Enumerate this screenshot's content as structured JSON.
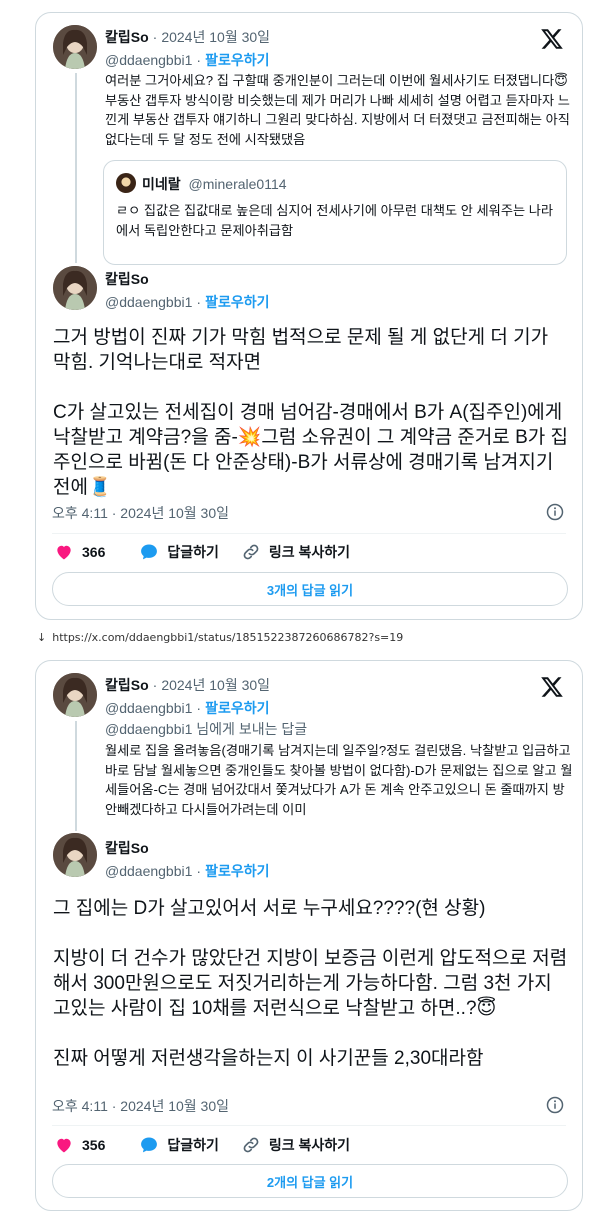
{
  "post1": {
    "parent": {
      "name": "칼립So",
      "date": "2024년 10월 30일",
      "handle": "@ddaengbbi1",
      "follow": "팔로우하기",
      "text": "여러분 그거아세요? 집 구할때 중개인분이 그러는데 이번에 월세사기도 터졌댑니다😇 부동산 갭투자 방식이랑 비슷했는데 제가 머리가 나빠 세세히 설명 어렵고 듣자마자 느낀게 부동산 갭투자 얘기하니 그원리 맞다하심. 지방에서 더 터졌댓고 금전피해는 아직없다는데 두 달 정도 전에 시작됐댔음"
    },
    "quote": {
      "name": "미네랄",
      "handle": "@minerale0114",
      "text": "ㄹㅇ 집값은 집값대로 높은데 심지어 전세사기에 아무런 대책도 안 세워주는 나라에서 독립안한다고 문제아취급함"
    },
    "main": {
      "name": "칼립So",
      "handle": "@ddaengbbi1",
      "follow": "팔로우하기",
      "para1": "그거 방법이 진짜 기가 막힘 법적으로 문제 될 게 없단게 더 기가 막힘. 기억나는대로 적자면",
      "para2": "C가 살고있는 전세집이 경매 넘어감-경매에서 B가 A(집주인)에게 낙찰받고 계약금?을 줌-💥그럼 소유권이 그 계약금 준거로 B가 집주인으로 바뀜(돈 다 안준상태)-B가 서류상에 경매기록 남겨지기전에🧵"
    },
    "timestamp": "오후 4:11 · 2024년 10월 30일",
    "likes": "366",
    "reply_label": "답글하기",
    "copy_label": "링크 복사하기",
    "read_replies": "3개의 답글 읽기"
  },
  "url_line": {
    "arrow": "↓",
    "url": "https://x.com/ddaengbbi1/status/1851522387260686782?s=19"
  },
  "post2": {
    "parent": {
      "name": "칼립So",
      "date": "2024년 10월 30일",
      "handle": "@ddaengbbi1",
      "follow": "팔로우하기",
      "reply_to": "@ddaengbbi1 님에게 보내는 답글",
      "text": "월세로 집을 올려놓음(경매기록 남겨지는데 일주일?정도 걸린댔음. 낙찰받고 입금하고 바로 담날 월세놓으면 중개인들도 찾아볼 방법이 없다함)-D가 문제없는 집으로 알고 월세들어옴-C는 경매 넘어갔대서 쫓겨났다가 A가 돈 계속 안주고있으니 돈 줄때까지 방 안빼겠다하고 다시들어가려는데 이미"
    },
    "main": {
      "name": "칼립So",
      "handle": "@ddaengbbi1",
      "follow": "팔로우하기",
      "para1": "그 집에는 D가 살고있어서 서로 누구세요????(현 상황)",
      "para2": "지방이 더 건수가 많았단건 지방이 보증금 이런게 압도적으로 저렴해서 300만원으로도 저짓거리하는게 가능하다함. 그럼 3천 가지고있는 사람이 집 10채를 저런식으로 낙찰받고 하면..?😇",
      "para3": "진짜 어떻게 저런생각을하는지 이 사기꾼들 2,30대라함"
    },
    "timestamp": "오후 4:11 · 2024년 10월 30일",
    "likes": "356",
    "reply_label": "답글하기",
    "copy_label": "링크 복사하기",
    "read_replies": "2개의 답글 읽기"
  },
  "colors": {
    "accent": "#1d9bf0",
    "like": "#f91880",
    "border": "#cfd9de",
    "muted": "#536471"
  },
  "icons": [
    "x-logo-icon",
    "heart-icon",
    "reply-bubble-icon",
    "link-icon",
    "info-icon"
  ]
}
